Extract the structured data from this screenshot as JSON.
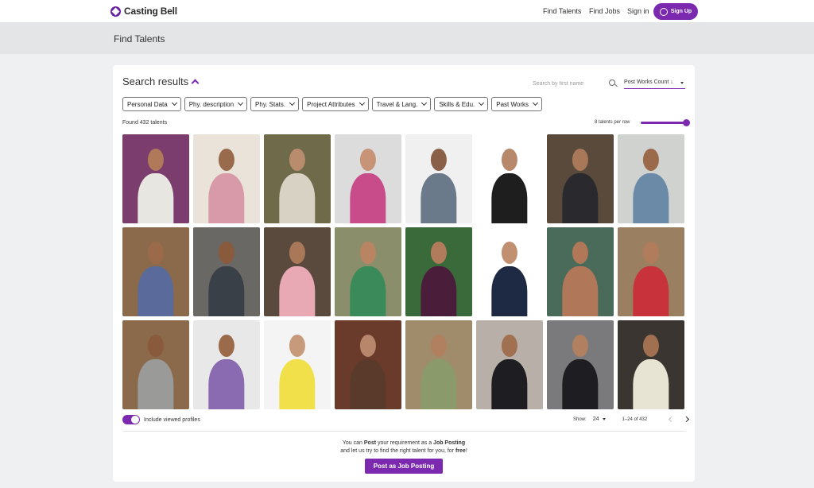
{
  "header": {
    "brand": "Casting Bell",
    "nav": [
      "Find Talents",
      "Find Jobs",
      "Sign in"
    ],
    "signup_label": "Sign Up"
  },
  "page": {
    "title": "Find Talents"
  },
  "search": {
    "title": "Search results",
    "placeholder": "Search by first name",
    "sort_label": "Post Works Count ↓"
  },
  "filters": [
    "Personal Data",
    "Phy. description",
    "Phy. Stats.",
    "Project Attributes",
    "Travel & Lang.",
    "Skills & Edu.",
    "Past Works"
  ],
  "results": {
    "found": "Found 432 talents",
    "per_row_label": "8 talents per row",
    "per_row": 8
  },
  "tiles": [
    {
      "bg": "#7a3d6e",
      "skin": "#b07a5a",
      "cloth": "#e8e6e0"
    },
    {
      "bg": "#e9e3da",
      "skin": "#9a6a4c",
      "cloth": "#d89aa8"
    },
    {
      "bg": "#6f6a4a",
      "skin": "#b88c6c",
      "cloth": "#d8d2c4"
    },
    {
      "bg": "#dcdcdc",
      "skin": "#c89478",
      "cloth": "#c84c8a"
    },
    {
      "bg": "#f0f0f0",
      "skin": "#8a6048",
      "cloth": "#6a7a8a"
    },
    {
      "bg": "#ffffff",
      "skin": "#b8886c",
      "cloth": "#1e1e1e"
    },
    {
      "bg": "#5a4a3c",
      "skin": "#a87858",
      "cloth": "#2a2a2e"
    },
    {
      "bg": "#d0d2d0",
      "skin": "#9a6a4a",
      "cloth": "#6a8aa8"
    },
    {
      "bg": "#8a6a4a",
      "skin": "#9a6a4a",
      "cloth": "#5a6a9a"
    },
    {
      "bg": "#6a6864",
      "skin": "#8a5a3c",
      "cloth": "#3a4048"
    },
    {
      "bg": "#5a4a3e",
      "skin": "#a87858",
      "cloth": "#e8a8b4"
    },
    {
      "bg": "#8a8e6a",
      "skin": "#b88462",
      "cloth": "#3a8a5a"
    },
    {
      "bg": "#3a6a3a",
      "skin": "#b07c5c",
      "cloth": "#4a1e3a"
    },
    {
      "bg": "#ffffff",
      "skin": "#c09070",
      "cloth": "#1e2a44"
    },
    {
      "bg": "#4a6a5a",
      "skin": "#b07858",
      "cloth": "#b07858"
    },
    {
      "bg": "#9a8060",
      "skin": "#b07c5c",
      "cloth": "#c8323a"
    },
    {
      "bg": "#8a6a4a",
      "skin": "#8a5a3c",
      "cloth": "#9a9a98"
    },
    {
      "bg": "#e8e8e8",
      "skin": "#9a6a4a",
      "cloth": "#8a6ab0"
    },
    {
      "bg": "#f4f4f4",
      "skin": "#c89a7c",
      "cloth": "#f2e04a"
    },
    {
      "bg": "#6a3a2a",
      "skin": "#b8866a",
      "cloth": "#5a3a2a"
    },
    {
      "bg": "#a08c6a",
      "skin": "#b08060",
      "cloth": "#8a9a6a"
    },
    {
      "bg": "#b8b0a8",
      "skin": "#a07050",
      "cloth": "#1e1e22"
    },
    {
      "bg": "#7a7a7c",
      "skin": "#b08060",
      "cloth": "#1e1e22"
    },
    {
      "bg": "#3a3530",
      "skin": "#a07050",
      "cloth": "#e8e4d4"
    }
  ],
  "bottom": {
    "toggle_label": "Include viewed profiles",
    "show_label": "Show:",
    "show_value": "24",
    "range": "1–24 of 432"
  },
  "footer": {
    "line1_pre": "You can ",
    "line1_bold1": "Post",
    "line1_mid": " your requirement as a ",
    "line1_bold2": "Job Posting",
    "line2_pre": "and let us try to find the right talent for you, for ",
    "line2_bold": "free",
    "line2_end": "!",
    "button": "Post as Job Posting"
  },
  "colors": {
    "accent": "#7b2ab0"
  }
}
